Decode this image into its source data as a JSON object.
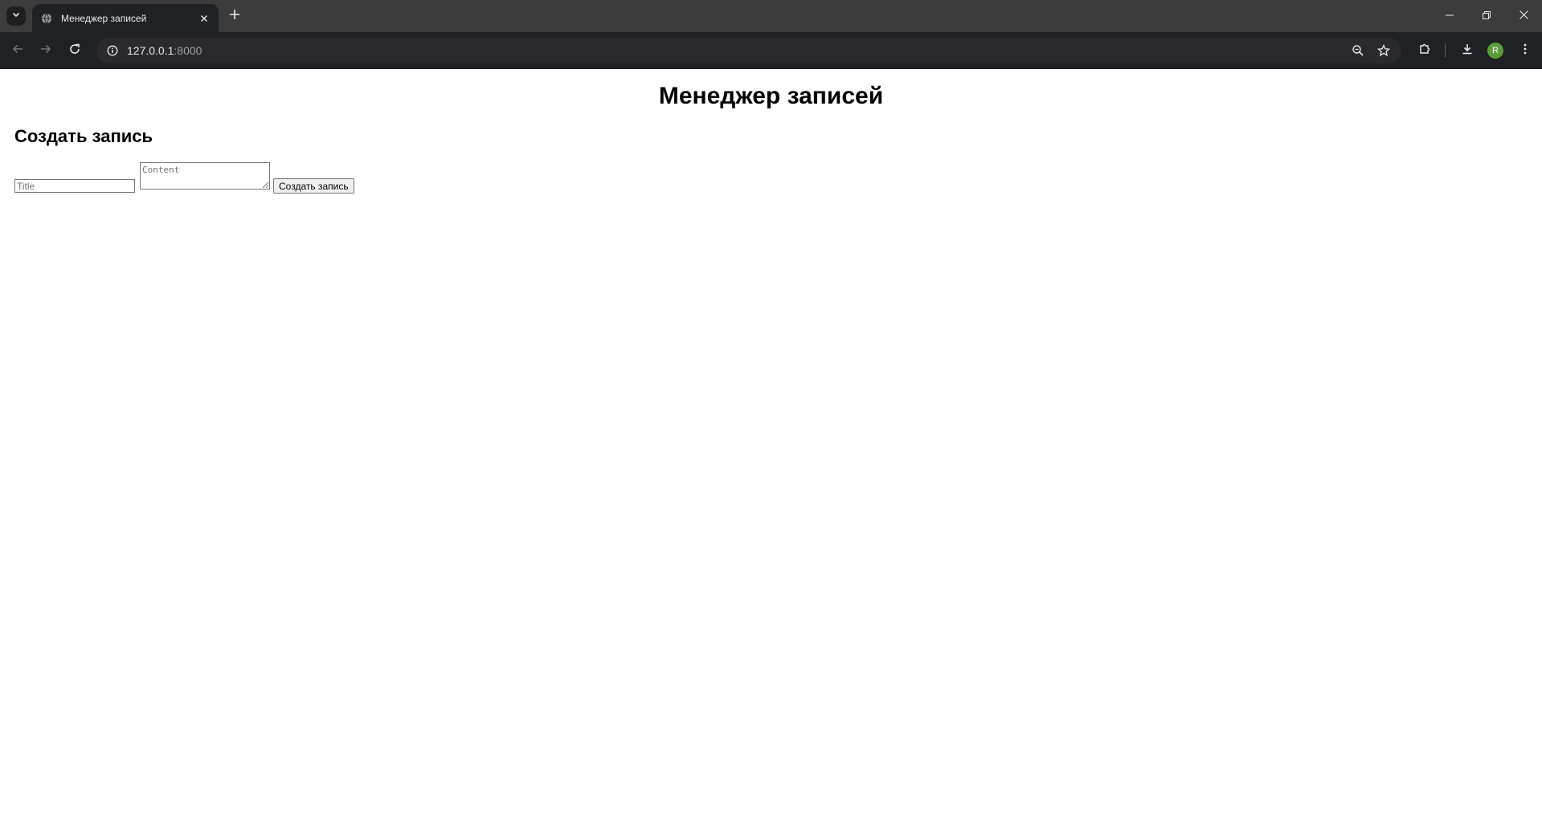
{
  "browser": {
    "tab": {
      "title": "Менеджер записей"
    },
    "address_bar": {
      "host": "127.0.0.1",
      "port": ":8000"
    },
    "profile_initial": "R",
    "icons": {
      "tab_search": "chevron-down-icon",
      "favicon": "globe-icon",
      "tab_close": "close-icon",
      "new_tab": "plus-icon",
      "minimize": "minimize-icon",
      "restore": "restore-icon",
      "close_window": "close-icon",
      "back": "arrow-left-icon",
      "forward": "arrow-right-icon",
      "reload": "reload-icon",
      "site_info": "info-icon",
      "zoom": "zoom-out-icon",
      "bookmark": "star-icon",
      "extensions": "puzzle-icon",
      "downloads": "download-icon",
      "menu": "kebab-menu-icon"
    },
    "colors": {
      "tabstrip": "#3c3c3c",
      "toolbar": "#202124",
      "avatar": "#5a9e3a"
    }
  },
  "page": {
    "heading": "Менеджер записей",
    "create_section": {
      "heading": "Создать запись",
      "title_input": {
        "value": "",
        "placeholder": "Title"
      },
      "content_textarea": {
        "value": "",
        "placeholder": "Content"
      },
      "submit_label": "Создать запись"
    }
  }
}
